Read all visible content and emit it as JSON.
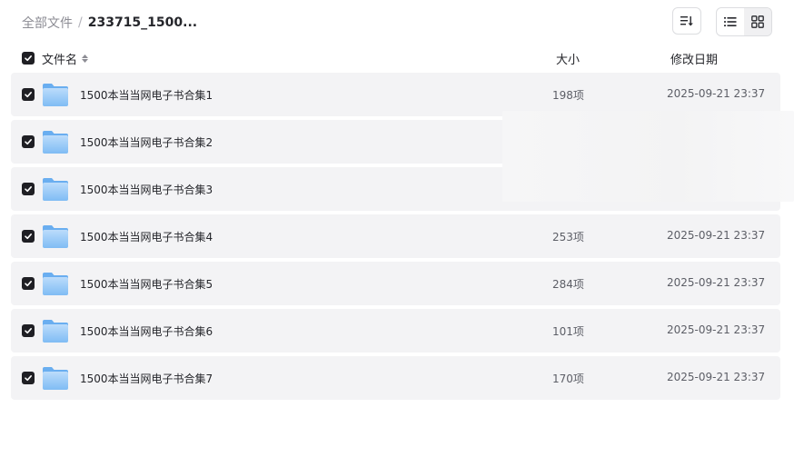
{
  "breadcrumb": {
    "root": "全部文件",
    "separator": "/",
    "current": "233715_1500..."
  },
  "columns": {
    "name": "文件名",
    "size": "大小",
    "modified": "修改日期"
  },
  "colors": {
    "checkbox": "#1f1f24",
    "folder_top": "#9dc9f4",
    "folder_bottom": "#5aaaf0",
    "row_bg": "#f3f3f5"
  },
  "rows": [
    {
      "name": "1500本当当网电子书合集1",
      "size": "198项",
      "date": "2025-09-21 23:37",
      "checked": true
    },
    {
      "name": "1500本当当网电子书合集2",
      "size": "",
      "date": "",
      "checked": true
    },
    {
      "name": "1500本当当网电子书合集3",
      "size": "",
      "date": "",
      "checked": true
    },
    {
      "name": "1500本当当网电子书合集4",
      "size": "253项",
      "date": "2025-09-21 23:37",
      "checked": true
    },
    {
      "name": "1500本当当网电子书合集5",
      "size": "284项",
      "date": "2025-09-21 23:37",
      "checked": true
    },
    {
      "name": "1500本当当网电子书合集6",
      "size": "101项",
      "date": "2025-09-21 23:37",
      "checked": true
    },
    {
      "name": "1500本当当网电子书合集7",
      "size": "170项",
      "date": "2025-09-21 23:37",
      "checked": true
    }
  ]
}
